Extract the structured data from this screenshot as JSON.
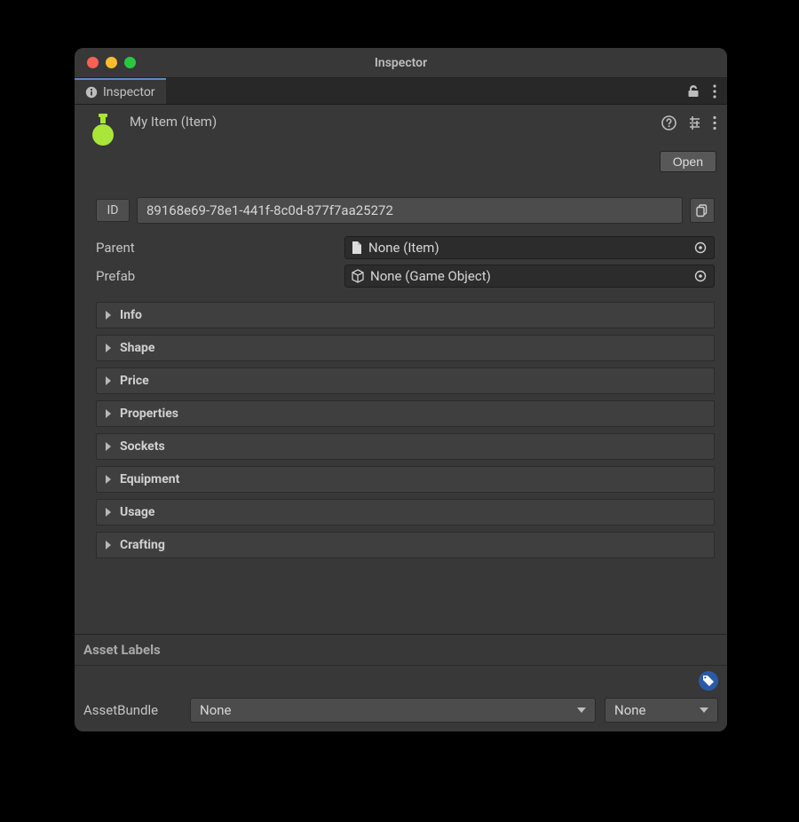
{
  "window": {
    "title": "Inspector"
  },
  "tab": {
    "label": "Inspector"
  },
  "header": {
    "item_title": "My Item (Item)",
    "open_button": "Open"
  },
  "id": {
    "label": "ID",
    "value": "89168e69-78e1-441f-8c0d-877f7aa25272"
  },
  "fields": {
    "parent": {
      "label": "Parent",
      "value": "None (Item)"
    },
    "prefab": {
      "label": "Prefab",
      "value": "None (Game Object)"
    }
  },
  "foldouts": [
    {
      "name": "Info"
    },
    {
      "name": "Shape"
    },
    {
      "name": "Price"
    },
    {
      "name": "Properties"
    },
    {
      "name": "Sockets"
    },
    {
      "name": "Equipment"
    },
    {
      "name": "Usage"
    },
    {
      "name": "Crafting"
    }
  ],
  "footer": {
    "asset_labels_title": "Asset Labels",
    "bundle_label": "AssetBundle",
    "bundle_value": "None",
    "variant_value": "None"
  }
}
